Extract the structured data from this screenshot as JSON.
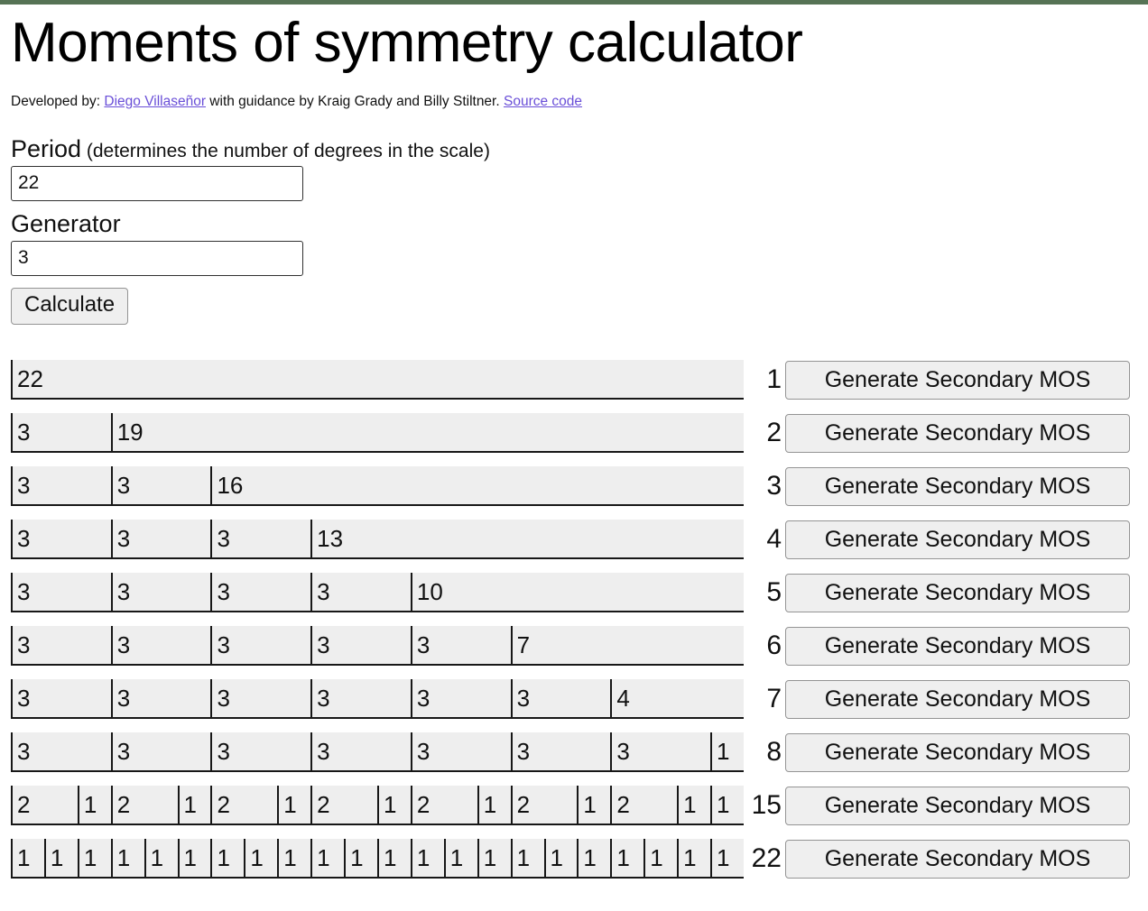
{
  "theme": {
    "top_band_color": "#567355",
    "link_color": "#6a4fd8",
    "cell_bg": "#eeeeee",
    "cell_border": "#171717",
    "button_bg": "#efefef"
  },
  "header": {
    "title": "Moments of symmetry calculator",
    "credit_prefix": "Developed by: ",
    "author_link": "Diego Villaseñor",
    "credit_middle": " with guidance by Kraig Grady and Billy Stiltner. ",
    "source_link": "Source code"
  },
  "form": {
    "period_label": "Period",
    "period_hint": " (determines the number of degrees in the scale)",
    "period_value": "22",
    "period_placeholder": "",
    "generator_label": "Generator",
    "generator_value": "3",
    "generator_placeholder": "",
    "calculate_label": "Calculate"
  },
  "results": {
    "generate_button_label": "Generate Secondary MOS",
    "period": 22,
    "rows": [
      {
        "degrees": "1",
        "steps": [
          22
        ]
      },
      {
        "degrees": "2",
        "steps": [
          3,
          19
        ]
      },
      {
        "degrees": "3",
        "steps": [
          3,
          3,
          16
        ]
      },
      {
        "degrees": "4",
        "steps": [
          3,
          3,
          3,
          13
        ]
      },
      {
        "degrees": "5",
        "steps": [
          3,
          3,
          3,
          3,
          10
        ]
      },
      {
        "degrees": "6",
        "steps": [
          3,
          3,
          3,
          3,
          3,
          7
        ]
      },
      {
        "degrees": "7",
        "steps": [
          3,
          3,
          3,
          3,
          3,
          3,
          4
        ]
      },
      {
        "degrees": "8",
        "steps": [
          3,
          3,
          3,
          3,
          3,
          3,
          3,
          1
        ]
      },
      {
        "degrees": "15",
        "steps": [
          2,
          1,
          2,
          1,
          2,
          1,
          2,
          1,
          2,
          1,
          2,
          1,
          2,
          1,
          1
        ]
      },
      {
        "degrees": "22",
        "steps": [
          1,
          1,
          1,
          1,
          1,
          1,
          1,
          1,
          1,
          1,
          1,
          1,
          1,
          1,
          1,
          1,
          1,
          1,
          1,
          1,
          1,
          1
        ]
      }
    ]
  }
}
